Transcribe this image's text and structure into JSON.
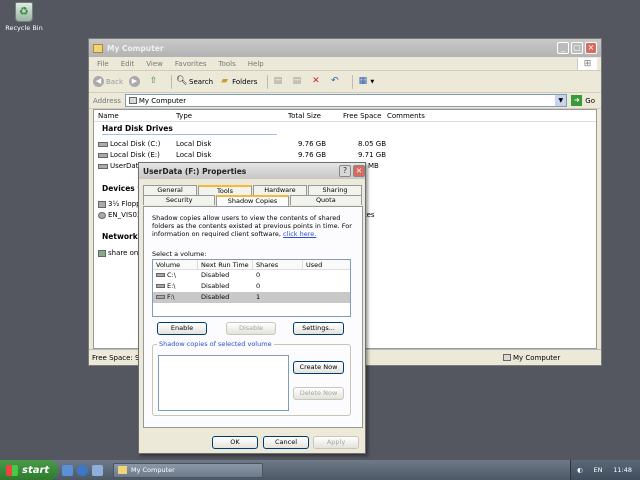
{
  "desktop": {
    "recycle_label": "Recycle Bin"
  },
  "explorer": {
    "title": "My Computer",
    "menu": [
      "File",
      "Edit",
      "View",
      "Favorites",
      "Tools",
      "Help"
    ],
    "toolbar": {
      "back": "Back",
      "search": "Search",
      "folders": "Folders"
    },
    "address_label": "Address",
    "address_value": "My Computer",
    "go_label": "Go",
    "columns": [
      "Name",
      "Type",
      "Total Size",
      "Free Space",
      "Comments"
    ],
    "sections": {
      "hard_disks": "Hard Disk Drives",
      "devices": "Devices wi",
      "network": "Network D"
    },
    "drives": [
      {
        "name": "Local Disk (C:)",
        "type": "Local Disk",
        "total": "9.76 GB",
        "free": "8.05 GB"
      },
      {
        "name": "Local Disk (E:)",
        "type": "Local Disk",
        "total": "9.76 GB",
        "free": "9.71 GB"
      },
      {
        "name": "UserData",
        "type": "",
        "total": "",
        "free": "MB"
      }
    ],
    "devices": [
      {
        "name": "3½ Floppy",
        "extra": ""
      },
      {
        "name": "EN_VIS03",
        "extra": "rtes"
      }
    ],
    "network": [
      {
        "name": "share on Y"
      }
    ],
    "status_left": "Free Space: 99",
    "status_right": "My Computer"
  },
  "dialog": {
    "title": "UserData (F:) Properties",
    "tabs_row1": [
      "General",
      "Tools",
      "Hardware",
      "Sharing"
    ],
    "tabs_row2": [
      "Security",
      "Shadow Copies",
      "Quota"
    ],
    "description": "Shadow copies allow users to view the contents of shared folders as the contents existed at previous points in time. For information on required client software,",
    "click_here": "click here.",
    "select_label": "Select a volume:",
    "vol_columns": [
      "Volume",
      "Next Run Time",
      "Shares",
      "Used"
    ],
    "volumes": [
      {
        "volume": "C:\\",
        "next": "Disabled",
        "shares": "0",
        "used": ""
      },
      {
        "volume": "E:\\",
        "next": "Disabled",
        "shares": "0",
        "used": ""
      },
      {
        "volume": "F:\\",
        "next": "Disabled",
        "shares": "1",
        "used": ""
      }
    ],
    "enable": "Enable",
    "disable": "Disable",
    "settings": "Settings...",
    "copies_legend": "Shadow copies of selected volume",
    "create_now": "Create Now",
    "delete_now": "Delete Now",
    "ok": "OK",
    "cancel": "Cancel",
    "apply": "Apply"
  },
  "taskbar": {
    "start": "start",
    "task": "My Computer",
    "lang": "EN",
    "time": "11:48"
  }
}
